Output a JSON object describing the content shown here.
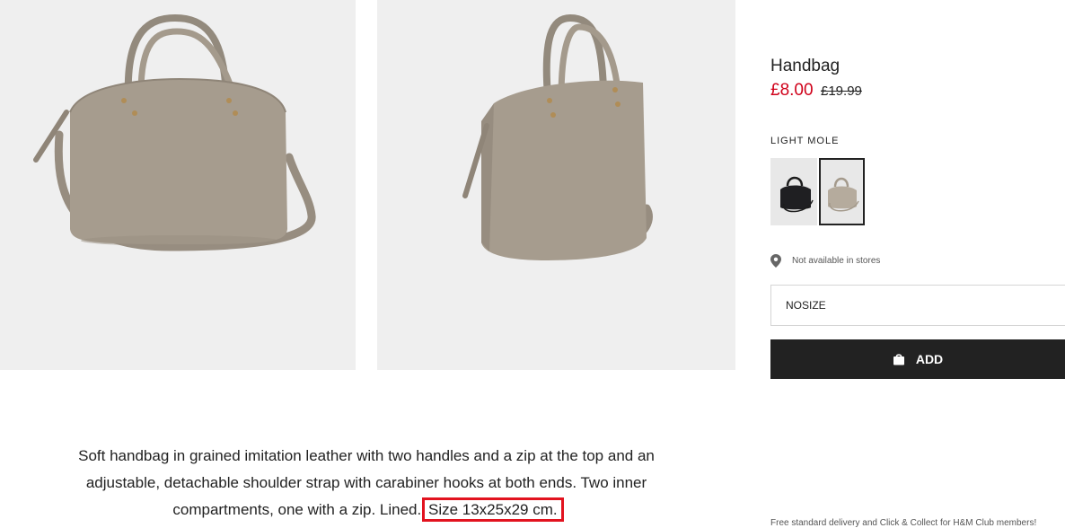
{
  "product": {
    "title": "Handbag",
    "price_sale": "£8.00",
    "price_original": "£19.99",
    "color_label": "LIGHT MOLE",
    "swatches": [
      {
        "name": "black",
        "selected": false
      },
      {
        "name": "light mole",
        "selected": true
      }
    ],
    "store_availability": "Not available in stores",
    "size_value": "NOSIZE",
    "add_button_label": "ADD",
    "delivery_note": "Free standard delivery and Click & Collect for H&M Club members!"
  },
  "description": {
    "text_main": "Soft handbag in grained imitation leather with two handles and a zip at the top and an adjustable, detachable shoulder strap with carabiner hooks at both ends. Two inner compartments, one with a zip. Lined.",
    "text_highlight": "Size 13x25x29 cm."
  },
  "colors": {
    "sale": "#d0021b",
    "button_bg": "#222222",
    "highlight_box": "#e2131f",
    "bag_taupe": "#a49a8c"
  }
}
